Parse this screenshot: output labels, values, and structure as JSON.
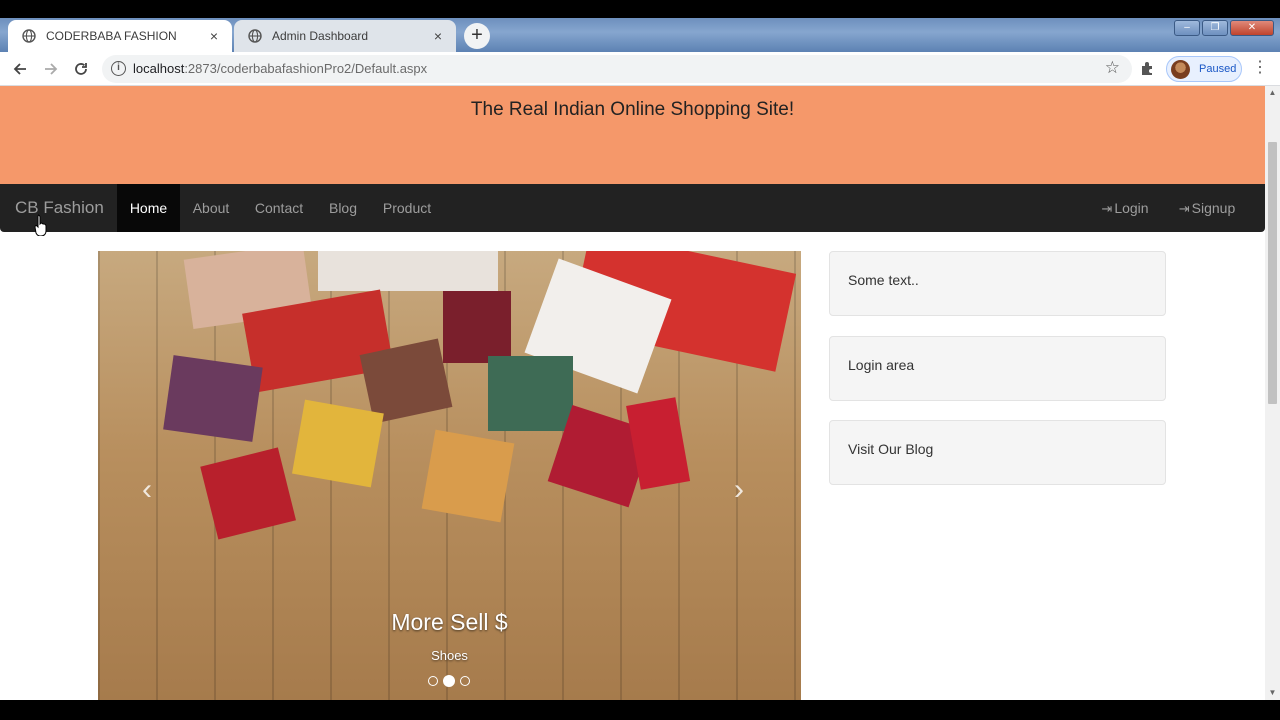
{
  "browser": {
    "tabs": [
      {
        "title": "CODERBABA FASHION",
        "active": true
      },
      {
        "title": "Admin Dashboard",
        "active": false
      }
    ],
    "url_host": "localhost",
    "url_rest": ":2873/coderbabafashionPro2/Default.aspx",
    "profile_status": "Paused",
    "tab_close_glyph": "×",
    "new_tab_glyph": "+",
    "window_controls": [
      "‒",
      "❐",
      "✕"
    ]
  },
  "site": {
    "tagline": "The Real Indian Online Shopping Site!",
    "brand": "CB Fashion",
    "nav": [
      {
        "label": "Home",
        "active": true
      },
      {
        "label": "About"
      },
      {
        "label": "Contact"
      },
      {
        "label": "Blog"
      },
      {
        "label": "Product"
      }
    ],
    "nav_right": [
      {
        "label": "Login",
        "icon": "login-icon"
      },
      {
        "label": "Signup",
        "icon": "login-icon"
      }
    ],
    "carousel": {
      "caption_title": "More Sell $",
      "caption_subtitle": "Shoes",
      "slide_count": 3,
      "active_slide": 2
    },
    "sidebar": [
      {
        "text": "Some text.."
      },
      {
        "text": "Login area"
      },
      {
        "text": "Visit Our Blog"
      }
    ]
  },
  "colors": {
    "header_banner": "#f5986a",
    "navbar": "#222222",
    "nav_active": "#080808"
  }
}
